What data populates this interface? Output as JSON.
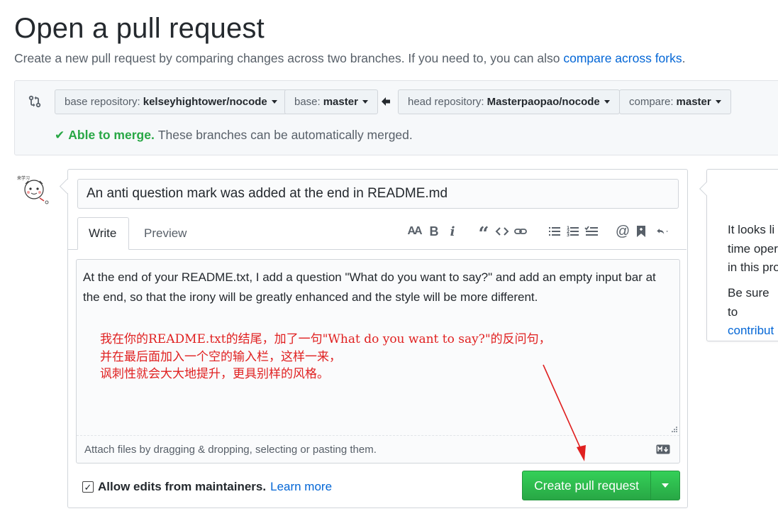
{
  "header": {
    "title": "Open a pull request",
    "subtitle": "Create a new pull request by comparing changes across two branches. If you need to, you can also ",
    "subtitle_link": "compare across forks",
    "subtitle_end": "."
  },
  "range": {
    "base_repo_label": "base repository:",
    "base_repo_value": "kelseyhightower/nocode",
    "base_label": "base:",
    "base_value": "master",
    "head_repo_label": "head repository:",
    "head_repo_value": "Masterpaopao/nocode",
    "compare_label": "compare:",
    "compare_value": "master",
    "merge_ok": "Able to merge.",
    "merge_text": "These branches can be automatically merged."
  },
  "form": {
    "title_value": "An anti question mark was added at the end in README.md",
    "tab_write": "Write",
    "tab_preview": "Preview",
    "toolbar": {
      "heading_icon": "text-size-icon",
      "bold_icon": "bold-icon",
      "italic_icon": "italic-icon",
      "quote_icon": "quote-icon",
      "code_icon": "code-icon",
      "link_icon": "link-icon",
      "ul_icon": "unordered-list-icon",
      "ol_icon": "ordered-list-icon",
      "task_icon": "task-list-icon",
      "mention_icon": "mention-icon",
      "bookmark_icon": "saved-reply-icon",
      "reply_icon": "reply-icon"
    },
    "body_text": "At the end of your README.txt, I add a question \"What do you want to say?\" and add an empty input bar at the end, so that the irony will be greatly enhanced and the style will be more different.",
    "annotation_lines": [
      "我在你的README.txt的结尾，加了一句\"What do you want to say?\"的反问句，",
      "并在最后面加入一个空的输入栏，这样一来，",
      "讽刺性就会大大地提升，更具别样的风格。"
    ],
    "attach_text": "Attach files by dragging & dropping, selecting or pasting them.",
    "allow_label": "Allow edits from maintainers.",
    "learn_more": "Learn more",
    "allow_checked": true,
    "create_label": "Create pull request"
  },
  "sidebar": {
    "lines": [
      "It looks li",
      "time oper",
      "in this pro"
    ],
    "line2": "Be sure to",
    "link": "contribut"
  },
  "colors": {
    "link": "#0366d6",
    "success": "#28a745",
    "annotation": "#e02020"
  }
}
